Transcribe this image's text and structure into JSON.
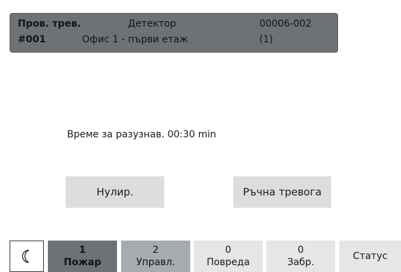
{
  "header": {
    "status": "Пров. трев.",
    "device_type": "Детектор",
    "address": "00006-002",
    "number": "#001",
    "location": "Офис 1 - първи етаж",
    "count": "(1)"
  },
  "main": {
    "timer_text": "Време за разузнав. 00:30 min",
    "reset_label": "Нулир.",
    "manual_alarm_label": "Ръчна тревога"
  },
  "tabs": {
    "night_icon": "moon-icon",
    "fire": {
      "count": "1",
      "label": "Пожар"
    },
    "control": {
      "count": "2",
      "label": "Управл."
    },
    "fault": {
      "count": "0",
      "label": "Повреда"
    },
    "disabled": {
      "count": "0",
      "label": "Забр."
    },
    "status": {
      "label": "Статус"
    }
  },
  "colors": {
    "header_bg": "#6e7175",
    "button_bg": "#dcdedd",
    "tab_active_bg": "#6e7175",
    "tab_secondary_bg": "#a8abae",
    "tab_inactive_bg": "#e5e6e6"
  }
}
